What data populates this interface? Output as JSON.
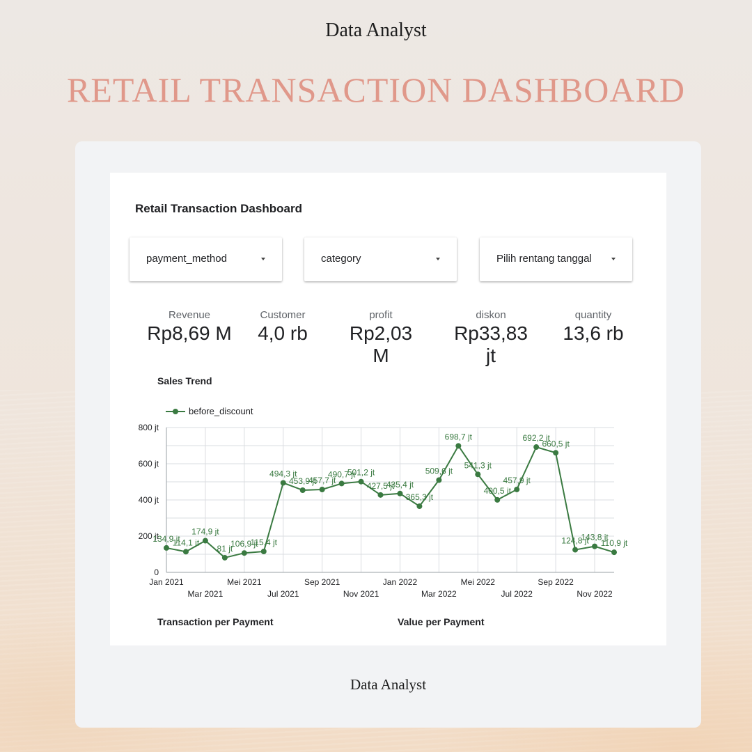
{
  "header": {
    "top_label": "Data Analyst",
    "headline": "RETAIL TRANSACTION DASHBOARD",
    "footer_label": "Data Analyst"
  },
  "report": {
    "title": "Retail Transaction Dashboard",
    "filters": [
      {
        "label": "payment_method"
      },
      {
        "label": "category"
      },
      {
        "label": "Pilih rentang tanggal"
      }
    ],
    "kpis": [
      {
        "label": "Revenue",
        "value": "Rp8,69 M"
      },
      {
        "label": "Customer",
        "value": "4,0 rb"
      },
      {
        "label": "profit",
        "value": "Rp2,03 M"
      },
      {
        "label": "diskon",
        "value": "Rp33,83 jt"
      },
      {
        "label": "quantity",
        "value": "13,6 rb"
      }
    ],
    "sales_trend_title": "Sales Trend",
    "transaction_title": "Transaction per Payment",
    "value_title": "Value per Payment"
  },
  "colors": {
    "headline": "#e0988a",
    "series": "#3a7a41",
    "grid": "#dadce0"
  },
  "chart_data": {
    "type": "line",
    "title": "Sales Trend",
    "legend_position": "top-left",
    "grid": true,
    "ylim": [
      0,
      800
    ],
    "y_ticks": [
      "0",
      "200 jt",
      "400 jt",
      "600 jt",
      "800 jt"
    ],
    "y_tick_values": [
      0,
      200,
      400,
      600,
      800
    ],
    "x_ticks_upper": [
      "Jan 2021",
      "Mei 2021",
      "Sep 2021",
      "Jan 2022",
      "Mei 2022",
      "Sep 2022"
    ],
    "x_ticks_lower": [
      "Mar 2021",
      "Jul 2021",
      "Nov 2021",
      "Mar 2022",
      "Jul 2022",
      "Nov 2022"
    ],
    "x": [
      "Jan 2021",
      "Feb 2021",
      "Mar 2021",
      "Apr 2021",
      "Mei 2021",
      "Jun 2021",
      "Jul 2021",
      "Agu 2021",
      "Sep 2021",
      "Okt 2021",
      "Nov 2021",
      "Des 2021",
      "Jan 2022",
      "Feb 2022",
      "Mar 2022",
      "Apr 2022",
      "Mei 2022",
      "Jun 2022",
      "Jul 2022",
      "Agu 2022",
      "Sep 2022",
      "Okt 2022",
      "Nov 2022",
      "Des 2022"
    ],
    "series": [
      {
        "name": "before_discount",
        "values": [
          134.9,
          114.1,
          174.9,
          81,
          106.9,
          115.4,
          494.3,
          453.9,
          457.7,
          490.7,
          501.2,
          427.5,
          435.4,
          365.3,
          509.6,
          698.7,
          541.3,
          400.5,
          457.9,
          692.2,
          660.5,
          124.8,
          143.8,
          110.9
        ],
        "labels": [
          "134,9 jt",
          "114,1 jt",
          "174,9 jt",
          "81 jt",
          "106,9 jt",
          "115,4 jt",
          "494,3 jt",
          "453,9 jt",
          "457,7 jt",
          "490,7 jt",
          "501,2 jt",
          "427,5 jt",
          "435,4 jt",
          "365,3 jt",
          "509,6 jt",
          "698,7 jt",
          "541,3 jt",
          "400,5 jt",
          "457,9 jt",
          "692,2 jt",
          "660,5 jt",
          "124,8 jt",
          "143,8 jt",
          "110,9 jt"
        ]
      }
    ]
  }
}
